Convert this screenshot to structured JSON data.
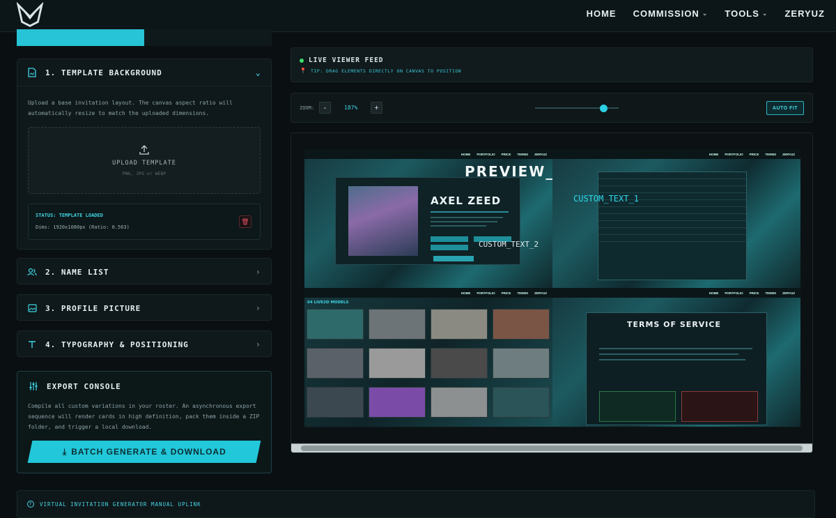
{
  "nav": {
    "items": [
      "HOME",
      "COMMISSION",
      "TOOLS",
      "ZERYUZ"
    ]
  },
  "sidebar": {
    "sections": [
      {
        "label": "1. TEMPLATE BACKGROUND"
      },
      {
        "label": "2. NAME LIST"
      },
      {
        "label": "3. PROFILE PICTURE"
      },
      {
        "label": "4. TYPOGRAPHY & POSITIONING"
      }
    ],
    "template": {
      "description": "Upload a base invitation layout. The canvas aspect ratio will automatically resize to match the uploaded dimensions.",
      "upload_label": "UPLOAD TEMPLATE",
      "upload_hint": "PNG, JPG or WEBP",
      "status": "STATUS: TEMPLATE LOADED",
      "dims": "Dims: 1920x1080px (Ratio: 0.563)"
    },
    "export": {
      "title": "EXPORT CONSOLE",
      "description": "Compile all custom variations in your roster. An asynchronous export sequence will render cards in high definition, pack them inside a ZIP folder, and trigger a local download.",
      "button": "BATCH GENERATE & DOWNLOAD"
    }
  },
  "feed": {
    "title": "LIVE VIEWER FEED",
    "tip": "TIP: DRAG ELEMENTS DIRECTLY ON CANVAS TO POSITION"
  },
  "zoom": {
    "label": "ZOOM:",
    "minus": "-",
    "plus": "+",
    "value": "187%",
    "level": 0.82,
    "autofit": "AUTO FIT"
  },
  "canvas": {
    "preview_name": "PREVIEW_NAME",
    "custom_text_1": "CUSTOM_TEXT_1",
    "custom_text_2": "CUSTOM_TEXT_2",
    "nav_items": [
      "HOME",
      "PORTFOLIO",
      "PRICE",
      "TERMS",
      "ZERYUZ"
    ],
    "character_name": "AXEL ZEED",
    "models_title": "04 LIVE2D MODELS",
    "tos_title": "TERMS OF SERVICE"
  },
  "manual": {
    "label": "VIRTUAL INVITATION GENERATOR MANUAL UPLINK"
  },
  "colors": {
    "accent": "#27c3d6",
    "live_dot": "#3ddc6a",
    "danger": "#e05060"
  }
}
